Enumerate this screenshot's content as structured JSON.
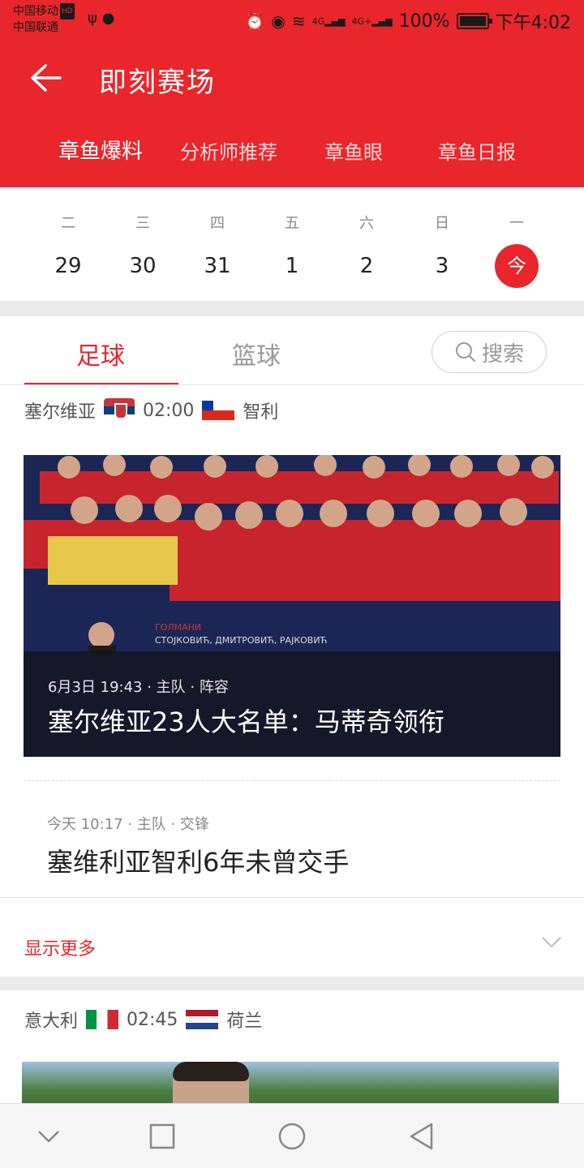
{
  "status_bar": {
    "carrier1": "中国移动",
    "carrier1_badge": "HD",
    "carrier2": "中国联通",
    "left_icons": [
      "usb-icon",
      "chat-icon"
    ],
    "right_icons": [
      "alarm-icon",
      "eye-icon",
      "wifi-icon",
      "signal-4g-icon",
      "signal-4g-plus-icon"
    ],
    "sig1": "4G",
    "sig2": "4G+",
    "battery": "100%",
    "time": "下午4:02"
  },
  "header": {
    "title": "即刻赛场",
    "back_icon": "back-arrow-icon",
    "color": "#e8262b"
  },
  "subnav": {
    "items": [
      "章鱼爆料",
      "分析师推荐",
      "章鱼眼",
      "章鱼日报"
    ],
    "active_index": 0
  },
  "calendar": {
    "days": [
      {
        "weekday": "二",
        "date": "29"
      },
      {
        "weekday": "三",
        "date": "30"
      },
      {
        "weekday": "四",
        "date": "31"
      },
      {
        "weekday": "五",
        "date": "1"
      },
      {
        "weekday": "六",
        "date": "2"
      },
      {
        "weekday": "日",
        "date": "3"
      },
      {
        "weekday": "一",
        "date": "今",
        "today": true
      }
    ]
  },
  "sport_tabs": {
    "items": [
      "足球",
      "篮球"
    ],
    "active_index": 0,
    "search_label": "搜索"
  },
  "matches": [
    {
      "home": "塞尔维亚",
      "time": "02:00",
      "away": "智利",
      "feature": {
        "meta": "6月3日 19:43 · 主队 · 阵容",
        "title": "塞尔维亚23人大名单：马蒂奇领衔",
        "image_text": [
          "ГОЛМАНИ",
          "СТОЈКОВИЋ, ДМИТРОВИЋ, РАЈКОВИЋ"
        ]
      },
      "item": {
        "meta": "今天 10:17 · 主队 · 交锋",
        "title": "塞维利亚智利6年未曾交手"
      },
      "show_more": "显示更多"
    },
    {
      "home": "意大利",
      "time": "02:45",
      "away": "荷兰"
    }
  ],
  "navbar": {
    "icons": [
      "nav-collapse-icon",
      "nav-recents-icon",
      "nav-home-icon",
      "nav-back-icon"
    ]
  }
}
